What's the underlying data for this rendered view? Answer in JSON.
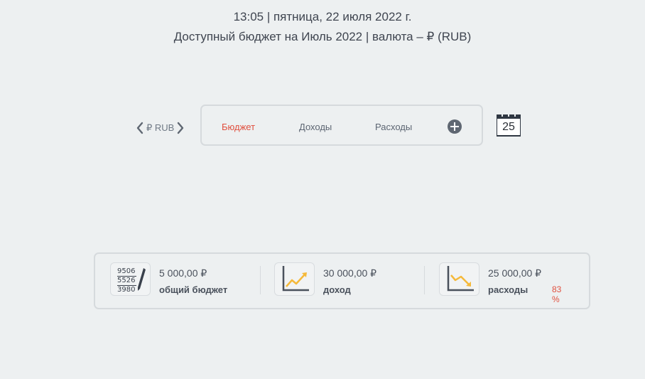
{
  "header": {
    "datetime": "13:05 | пятница, 22 июля 2022 г.",
    "budget_line": "Доступный бюджет на Июль 2022 | валюта – ₽ (RUB)"
  },
  "currency_switcher": {
    "label": "₽ RUB",
    "prev_icon": "chevron-left-icon",
    "next_icon": "chevron-right-icon"
  },
  "tabs": [
    {
      "label": "Бюджет",
      "active": true
    },
    {
      "label": "Доходы",
      "active": false
    },
    {
      "label": "Расходы",
      "active": false
    }
  ],
  "add_button_icon": "plus-circle-icon",
  "calendar": {
    "day": "25",
    "icon": "calendar-icon"
  },
  "summary": {
    "budget": {
      "amount": "5 000,00 ₽",
      "caption": "общий бюджет",
      "icon_lines": [
        "9506",
        "5526",
        "3980"
      ]
    },
    "income": {
      "amount": "30 000,00 ₽",
      "caption": "доход"
    },
    "expenses": {
      "amount": "25 000,00 ₽",
      "caption": "расходы",
      "percent": "83 %"
    }
  },
  "colors": {
    "background": "#edf0f1",
    "accent_red": "#e0503f",
    "chart_yellow": "#f5b93a",
    "text_dark": "#3f4550"
  }
}
